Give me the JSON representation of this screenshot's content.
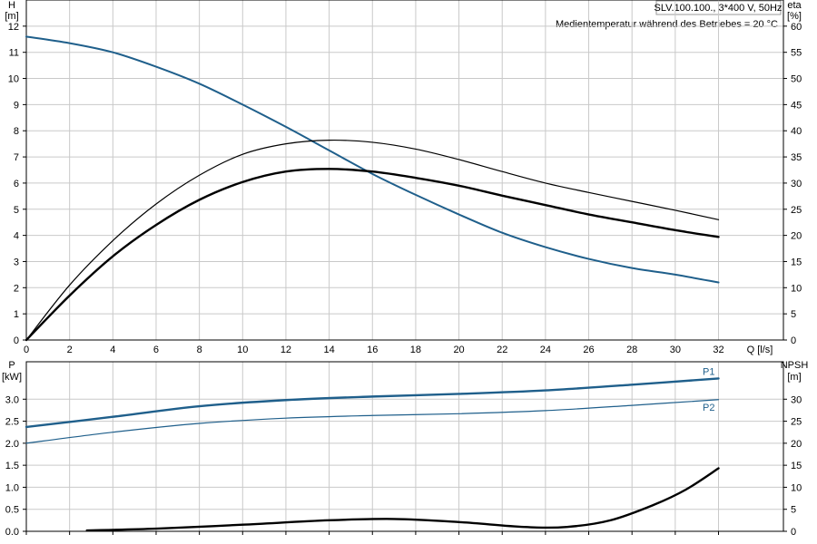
{
  "header": {
    "model": "SLV.100.100., 3*400 V, 50Hz",
    "medium_note": "Medientemperatur während des Betriebes = 20 °C"
  },
  "colors": {
    "blue": "#1f5f8b",
    "black": "#000000",
    "grid": "#c9c9c9"
  },
  "chart_data": [
    {
      "type": "line",
      "name": "top",
      "left_axis": {
        "label": "H",
        "unit": "[m]",
        "lim": [
          0,
          13
        ],
        "ticks": [
          0,
          1,
          2,
          3,
          4,
          5,
          6,
          7,
          8,
          9,
          10,
          11,
          12
        ]
      },
      "right_axis": {
        "label": "eta",
        "unit": "[%]",
        "lim": [
          0,
          65
        ],
        "ticks": [
          0,
          5,
          10,
          15,
          20,
          25,
          30,
          35,
          40,
          45,
          50,
          55,
          60
        ]
      },
      "x_axis": {
        "label": "Q",
        "unit": "[l/s]",
        "lim": [
          0,
          35
        ],
        "ticks": [
          0,
          2,
          4,
          6,
          8,
          10,
          12,
          14,
          16,
          18,
          20,
          22,
          24,
          26,
          28,
          30,
          32
        ]
      },
      "grid": true,
      "series": [
        {
          "key": "H",
          "axis": "left",
          "color": "#1f5f8b",
          "width": 2,
          "x": [
            0,
            2,
            4,
            6,
            8,
            10,
            12,
            14,
            16,
            18,
            20,
            22,
            24,
            26,
            28,
            30,
            32
          ],
          "y": [
            11.6,
            11.35,
            11.0,
            10.45,
            9.8,
            9.0,
            8.15,
            7.25,
            6.35,
            5.55,
            4.8,
            4.1,
            3.55,
            3.1,
            2.75,
            2.5,
            2.2
          ]
        },
        {
          "key": "eta_thin",
          "axis": "right",
          "color": "#000000",
          "width": 1.2,
          "x": [
            0,
            2,
            4,
            6,
            8,
            10,
            12,
            14,
            16,
            18,
            20,
            22,
            24,
            26,
            28,
            30,
            32
          ],
          "y": [
            0,
            10.5,
            19,
            26,
            31.5,
            35.5,
            37.5,
            38.2,
            37.8,
            36.5,
            34.5,
            32.2,
            30,
            28.2,
            26.5,
            24.8,
            23
          ]
        },
        {
          "key": "eta_bold",
          "axis": "right",
          "color": "#000000",
          "width": 2.4,
          "x": [
            0,
            2,
            4,
            6,
            8,
            10,
            12,
            14,
            16,
            18,
            20,
            22,
            24,
            26,
            28,
            30,
            32
          ],
          "y": [
            0,
            8.5,
            16,
            22,
            26.8,
            30.2,
            32.2,
            32.7,
            32.2,
            31,
            29.5,
            27.6,
            25.8,
            24,
            22.5,
            21,
            19.7
          ]
        }
      ]
    },
    {
      "type": "line",
      "name": "bottom",
      "left_axis": {
        "label": "P",
        "unit": "[kW]",
        "lim": [
          0,
          3.85
        ],
        "ticks": [
          0.0,
          0.5,
          1.0,
          1.5,
          2.0,
          2.5,
          3.0
        ],
        "tick_labels": [
          "0.0",
          "0.5",
          "1.0",
          "1.5",
          "2.0",
          "2.5",
          "3.0"
        ]
      },
      "right_axis": {
        "label": "NPSH",
        "unit": "[m]",
        "lim": [
          0,
          38.5
        ],
        "ticks": [
          0,
          5,
          10,
          15,
          20,
          25,
          30
        ]
      },
      "x_axis": {
        "lim": [
          0,
          35
        ],
        "ticks": [
          0,
          2,
          4,
          6,
          8,
          10,
          12,
          14,
          16,
          18,
          20,
          22,
          24,
          26,
          28,
          30,
          32
        ]
      },
      "grid": true,
      "series": [
        {
          "key": "P1",
          "name": "P1",
          "axis": "left",
          "color": "#1f5f8b",
          "width": 2.4,
          "x": [
            0,
            4,
            8,
            12,
            16,
            20,
            24,
            28,
            32
          ],
          "y": [
            2.37,
            2.6,
            2.84,
            2.98,
            3.06,
            3.12,
            3.2,
            3.33,
            3.47
          ]
        },
        {
          "key": "P2",
          "name": "P2",
          "axis": "left",
          "color": "#1f5f8b",
          "width": 1.2,
          "x": [
            0,
            4,
            8,
            12,
            16,
            20,
            24,
            28,
            32
          ],
          "y": [
            2.0,
            2.25,
            2.45,
            2.57,
            2.63,
            2.67,
            2.74,
            2.86,
            2.99
          ]
        },
        {
          "key": "NPSH",
          "axis": "right",
          "color": "#000000",
          "width": 2.4,
          "x": [
            2.8,
            6,
            10,
            14,
            17,
            20,
            23,
            25,
            27,
            29,
            30.5,
            32
          ],
          "y": [
            0.2,
            0.6,
            1.5,
            2.5,
            2.8,
            2.1,
            1.0,
            1.0,
            2.5,
            6.0,
            9.5,
            14.3
          ]
        }
      ]
    }
  ]
}
